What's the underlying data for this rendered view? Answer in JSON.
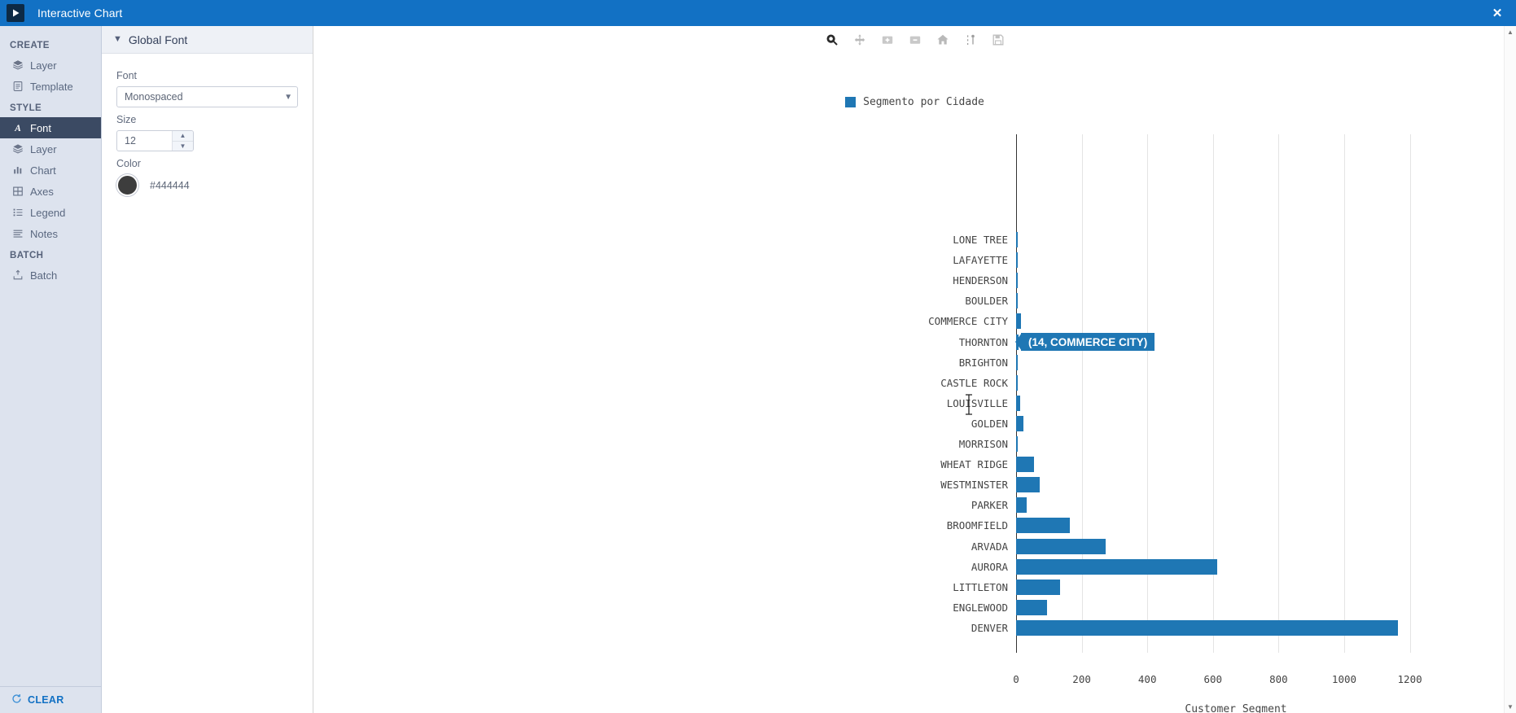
{
  "window": {
    "title": "Interactive Chart",
    "logo_icon": "play-triangle-icon",
    "close_label": "✕"
  },
  "sidebar": {
    "groups": [
      {
        "title": "CREATE",
        "items": [
          {
            "label": "Layer",
            "icon": "layers-icon",
            "active": false
          },
          {
            "label": "Template",
            "icon": "template-icon",
            "active": false
          }
        ]
      },
      {
        "title": "STYLE",
        "items": [
          {
            "label": "Font",
            "icon": "font-a-icon",
            "active": true
          },
          {
            "label": "Layer",
            "icon": "layers-icon",
            "active": false
          },
          {
            "label": "Chart",
            "icon": "bar-chart-icon",
            "active": false
          },
          {
            "label": "Axes",
            "icon": "grid-icon",
            "active": false
          },
          {
            "label": "Legend",
            "icon": "list-icon",
            "active": false
          },
          {
            "label": "Notes",
            "icon": "lines-icon",
            "active": false
          }
        ]
      },
      {
        "title": "BATCH",
        "items": [
          {
            "label": "Batch",
            "icon": "batch-upload-icon",
            "active": false
          }
        ]
      }
    ],
    "clear_button": {
      "label": "CLEAR",
      "icon": "refresh-icon"
    }
  },
  "properties": {
    "header": "Global Font",
    "font": {
      "label": "Font",
      "value": "Monospaced"
    },
    "size": {
      "label": "Size",
      "value": "12"
    },
    "color": {
      "label": "Color",
      "hex": "#444444",
      "swatch": "#3d3d3d"
    }
  },
  "toolbar": {
    "buttons": [
      {
        "name": "zoom-rect-icon",
        "tooltip": "Zoom to rectangle",
        "state": "active"
      },
      {
        "name": "pan-move-icon",
        "tooltip": "Pan",
        "state": "normal"
      },
      {
        "name": "zoom-in-icon",
        "tooltip": "Zoom in",
        "state": "normal"
      },
      {
        "name": "zoom-out-icon",
        "tooltip": "Zoom out",
        "state": "normal"
      },
      {
        "name": "home-icon",
        "tooltip": "Reset view",
        "state": "normal"
      },
      {
        "name": "configure-subplots-icon",
        "tooltip": "Configure",
        "state": "normal"
      },
      {
        "name": "save-floppy-icon",
        "tooltip": "Save figure",
        "state": "normal"
      }
    ]
  },
  "tooltip": {
    "text": "(14, COMMERCE CITY)"
  },
  "chart_data": {
    "type": "bar",
    "orientation": "horizontal",
    "title": "",
    "xlabel": "Customer Segment",
    "ylabel": "",
    "xlim": [
      0,
      1340
    ],
    "xticks": [
      0,
      200,
      400,
      600,
      800,
      1000,
      1200
    ],
    "grid": true,
    "legend": {
      "position": "top-center",
      "entries": [
        {
          "label": "Segmento por Cidade",
          "color": "#1f77b4"
        }
      ]
    },
    "bar_color": "#1f77b4",
    "categories": [
      "LONE TREE",
      "LAFAYETTE",
      "HENDERSON",
      "BOULDER",
      "COMMERCE CITY",
      "THORNTON",
      "BRIGHTON",
      "CASTLE ROCK",
      "LOUISVILLE",
      "GOLDEN",
      "MORRISON",
      "WHEAT RIDGE",
      "WESTMINSTER",
      "PARKER",
      "BROOMFIELD",
      "ARVADA",
      "AURORA",
      "LITTLETON",
      "ENGLEWOOD",
      "DENVER"
    ],
    "values": [
      3,
      6,
      3,
      4,
      14,
      8,
      4,
      4,
      12,
      22,
      5,
      55,
      71,
      33,
      165,
      273,
      612,
      133,
      95,
      1165
    ],
    "highlighted_category": "COMMERCE CITY",
    "highlighted_value": 14
  }
}
